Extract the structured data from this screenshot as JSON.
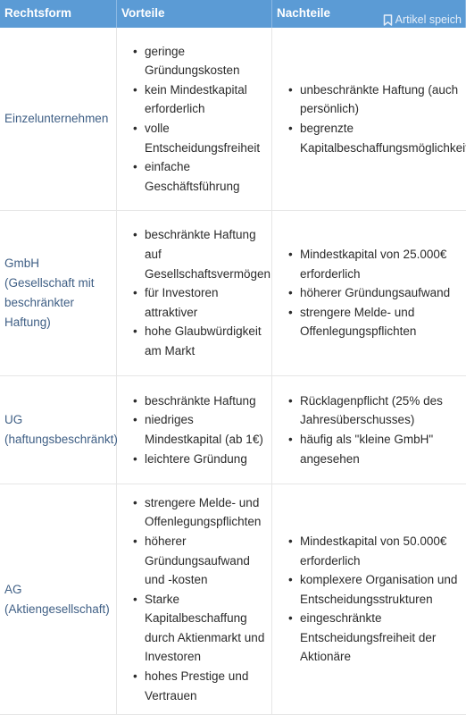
{
  "header": {
    "col1": "Rechtsform",
    "col2": "Vorteile",
    "col3": "Nachteile",
    "save_label": "Artikel speich"
  },
  "rows": [
    {
      "form": "Einzelunternehmen",
      "pros": [
        "geringe Gründungskosten",
        "kein Mindestkapital erforderlich",
        "volle Entscheidungsfreiheit",
        "einfache Geschäftsführung"
      ],
      "cons": [
        "unbeschränkte Haftung (auch persönlich)",
        "begrenzte Kapitalbeschaffungsmöglichkeiten"
      ]
    },
    {
      "form": "GmbH (Gesellschaft mit beschränkter Haftung)",
      "pros": [
        "beschränkte Haftung auf Gesellschaftsvermögen",
        "für Investoren attraktiver",
        "hohe Glaubwürdigkeit am Markt"
      ],
      "cons": [
        "Mindestkapital von 25.000€ erforderlich",
        "höherer Gründungsaufwand",
        "strengere Melde- und Offenlegungspflichten"
      ]
    },
    {
      "form": "UG (haftungsbeschränkt)",
      "pros": [
        "beschränkte Haftung",
        "niedriges Mindestkapital (ab 1€)",
        "leichtere Gründung"
      ],
      "cons": [
        "Rücklagenpflicht (25% des Jahresüberschusses)",
        "häufig als \"kleine GmbH\" angesehen"
      ]
    },
    {
      "form": "AG (Aktiengesellschaft)",
      "pros": [
        "strengere Melde- und Offenlegungspflichten",
        "höherer Gründungsaufwand und -kosten",
        "Starke Kapitalbeschaffung durch Aktienmarkt und Investoren",
        "hohes Prestige und Vertrauen"
      ],
      "cons": [
        "Mindestkapital von 50.000€ erforderlich",
        "komplexere Organisation und Entscheidungsstrukturen",
        "eingeschränkte Entscheidungsfreiheit der Aktionäre"
      ]
    }
  ]
}
